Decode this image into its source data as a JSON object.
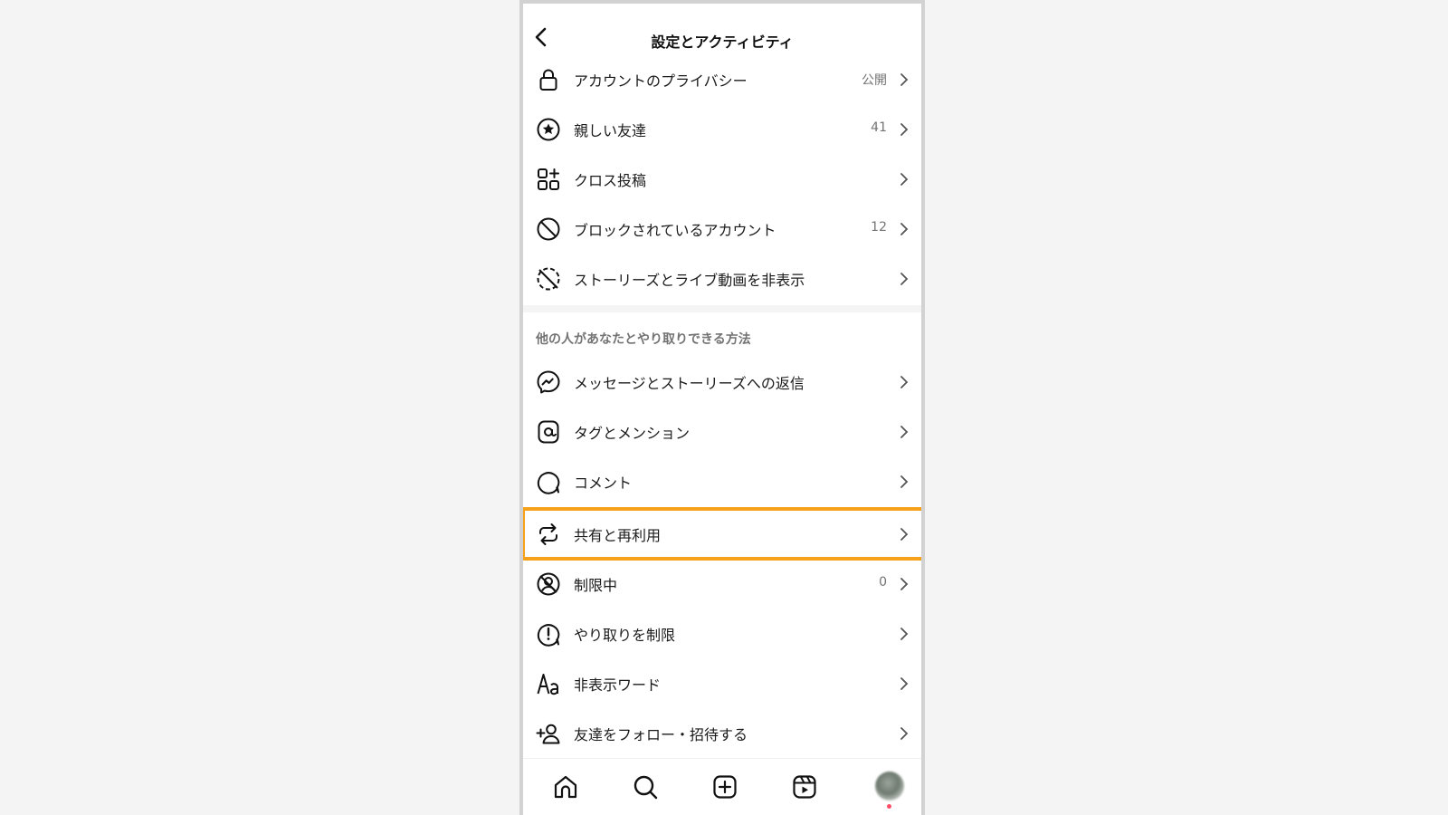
{
  "header": {
    "title": "設定とアクティビティ"
  },
  "items_top": [
    {
      "label": "アカウントのプライバシー",
      "value": "公開",
      "icon": "lock-icon"
    },
    {
      "label": "親しい友達",
      "value": "41",
      "icon": "star-circle-icon"
    },
    {
      "label": "クロス投稿",
      "value": "",
      "icon": "apps-plus-icon"
    },
    {
      "label": "ブロックされているアカウント",
      "value": "12",
      "icon": "block-icon"
    },
    {
      "label": "ストーリーズとライブ動画を非表示",
      "value": "",
      "icon": "story-hidden-icon"
    }
  ],
  "section": {
    "title": "他の人があなたとやり取りできる方法"
  },
  "items_bottom": [
    {
      "label": "メッセージとストーリーズへの返信",
      "value": "",
      "icon": "messenger-icon"
    },
    {
      "label": "タグとメンション",
      "value": "",
      "icon": "at-sign-icon"
    },
    {
      "label": "コメント",
      "value": "",
      "icon": "comment-icon"
    },
    {
      "label": "共有と再利用",
      "value": "",
      "icon": "share-reuse-icon"
    },
    {
      "label": "制限中",
      "value": "0",
      "icon": "restricted-icon"
    },
    {
      "label": "やり取りを制限",
      "value": "",
      "icon": "limit-interaction-icon"
    },
    {
      "label": "非表示ワード",
      "value": "",
      "icon": "text-aa-icon"
    },
    {
      "label": "友達をフォロー・招待する",
      "value": "",
      "icon": "add-person-icon"
    }
  ],
  "highlight_color": "#f7a01a",
  "bottom_nav": [
    "home-icon",
    "search-icon",
    "create-icon",
    "reels-icon",
    "profile-avatar"
  ]
}
